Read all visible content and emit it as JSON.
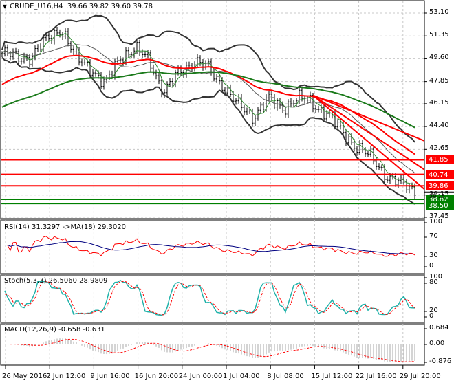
{
  "header": {
    "symbol": "CRUDE_U16,H4",
    "ohlc": "39.66 39.82 39.60 39.78"
  },
  "indicators": {
    "rsi": "RSI(14) 31.3297  ->MA(18) 29.3020",
    "stoch": "Stoch(5,3,3) 26.5060 28.9809",
    "macd": "MACD(12,26,9) -0.658 -0.631"
  },
  "colors": {
    "up": "#000000",
    "red": "#ff0000",
    "green": "#1a7a1a",
    "band": "#333333",
    "rsi_ma": "#000080",
    "stoch_main": "#20b2aa"
  },
  "chart_data": {
    "type": "line",
    "title": "CRUDE_U16,H4",
    "price_axis": {
      "ticks": [
        "53.10",
        "51.35",
        "49.60",
        "47.85",
        "46.15",
        "44.40",
        "42.65",
        "39.15",
        "37.45"
      ],
      "range": [
        37.45,
        53.1
      ]
    },
    "time_labels": [
      "26 May 2016",
      "2 Jun 12:00",
      "9 Jun 16:00",
      "16 Jun 20:00",
      "24 Jun 00:00",
      "1 Jul 04:00",
      "8 Jul 08:00",
      "15 Jul 12:00",
      "22 Jul 16:00",
      "29 Jul 20:00"
    ],
    "close_control_points": [
      50.0,
      49.7,
      49.8,
      51.0,
      52.0,
      49.6,
      49.0,
      47.5,
      49.8,
      50.3,
      49.5,
      47.0,
      48.5,
      49.5,
      48.8,
      47.6,
      46.0,
      45.2,
      46.5,
      45.8,
      46.6,
      46.2,
      45.5,
      44.0,
      43.0,
      42.0,
      40.8,
      40.0,
      39.5
    ],
    "horizontal_levels": [
      {
        "price": "41.85",
        "color": "#ff0000"
      },
      {
        "price": "40.74",
        "color": "#ff0000"
      },
      {
        "price": "39.86",
        "color": "#ff0000"
      },
      {
        "price": "38.82",
        "color": "#008000"
      },
      {
        "price": "38.50",
        "color": "#008000"
      }
    ],
    "current_price_label": "39.15",
    "trendlines": [
      {
        "from_price": 46.8,
        "to_price": 43.3
      },
      {
        "from_price": 46.8,
        "to_price": 41.1
      },
      {
        "from_price": 46.8,
        "to_price": 39.6
      }
    ],
    "rsi_axis": [
      "100",
      "70",
      "30",
      "0"
    ],
    "stoch_axis": [
      "100",
      "80",
      "20",
      "0"
    ],
    "macd_axis": [
      "0.684",
      "0.00",
      "-0.876"
    ]
  }
}
